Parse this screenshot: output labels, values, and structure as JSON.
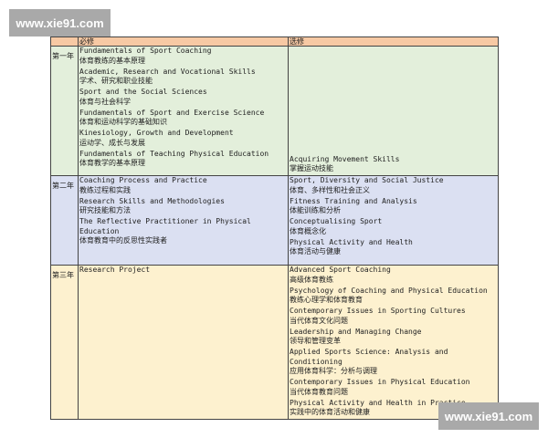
{
  "watermark": "www.xie91.com",
  "header": {
    "year": "",
    "required": "必修",
    "elective": "选修"
  },
  "colors": {
    "header": "#f7c9a4",
    "year1": "#e3efdb",
    "year2": "#dbe0f2",
    "year3": "#fdf1cf"
  },
  "rows": [
    {
      "year": "第一年",
      "required": [
        {
          "en": "Fundamentals of Sport Coaching",
          "zh": "体育教练的基本原理"
        },
        {
          "en": "Academic, Research and Vocational Skills",
          "zh": "学术、研究和职业技能"
        },
        {
          "en": "Sport and the Social Sciences",
          "zh": "体育与社会科学"
        },
        {
          "en": "Fundamentals of Sport and Exercise Science",
          "zh": "体育和运动科学的基础知识"
        },
        {
          "en": "Kinesiology, Growth and Development",
          "zh": "运动学、成长与发展"
        },
        {
          "en": "Fundamentals of Teaching Physical Education",
          "zh": "体育教学的基本原理"
        }
      ],
      "elective": [
        {
          "en": "Acquiring Movement Skills",
          "zh": "掌握运动技能"
        }
      ]
    },
    {
      "year": "第二年",
      "required": [
        {
          "en": "Coaching Process and Practice",
          "zh": "教练过程和实践"
        },
        {
          "en": "Research Skills and Methodologies",
          "zh": "研究技能和方法"
        },
        {
          "en": "The Reflective Practitioner in Physical Education",
          "zh": "体育教育中的反思性实践者"
        }
      ],
      "elective": [
        {
          "en": "Sport, Diversity and Social Justice",
          "zh": "体育、多样性和社会正义"
        },
        {
          "en": "Fitness Training and Analysis",
          "zh": "体能训练和分析"
        },
        {
          "en": "Conceptualising Sport",
          "zh": "体育概念化"
        },
        {
          "en": "Physical Activity and Health",
          "zh": "体育活动与健康"
        }
      ]
    },
    {
      "year": "第三年",
      "required": [
        {
          "en": "Research Project",
          "zh": ""
        }
      ],
      "elective": [
        {
          "en": "Advanced Sport Coaching",
          "zh": "高级体育教练"
        },
        {
          "en": "Psychology of Coaching and Physical Education",
          "zh": "教练心理学和体育教育"
        },
        {
          "en": "Contemporary Issues in Sporting Cultures",
          "zh": "当代体育文化问题"
        },
        {
          "en": "Leadership and Managing Change",
          "zh": "领导和管理变革"
        },
        {
          "en": "Applied Sports Science: Analysis and Conditioning",
          "zh": "应用体育科学：分析与调理"
        },
        {
          "en": "Contemporary Issues in Physical Education",
          "zh": "当代体育教育问题"
        },
        {
          "en": "Physical Activity and Health in Practice",
          "zh": "实践中的体育活动和健康"
        }
      ]
    }
  ]
}
